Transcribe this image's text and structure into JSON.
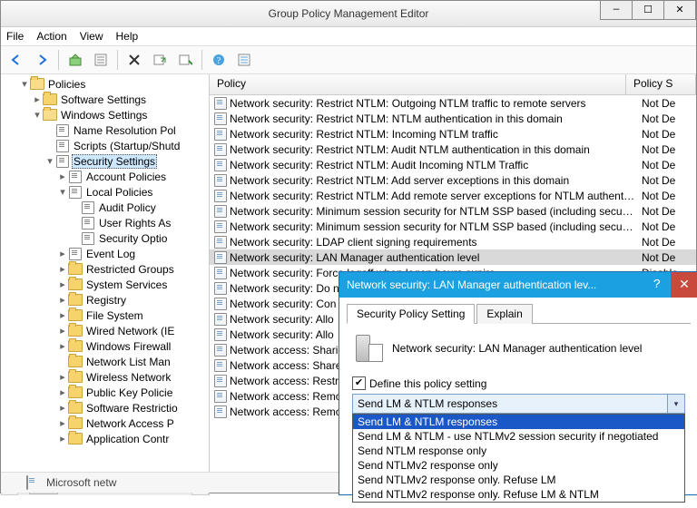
{
  "window": {
    "title": "Group Policy Management Editor",
    "menus": [
      "File",
      "Action",
      "View",
      "Help"
    ]
  },
  "tree": {
    "root": "Policies",
    "items": [
      {
        "depth": 1,
        "twist": "▾",
        "icon": "folder-open",
        "label": "Policies"
      },
      {
        "depth": 2,
        "twist": "▸",
        "icon": "folder",
        "label": "Software Settings"
      },
      {
        "depth": 2,
        "twist": "▾",
        "icon": "folder-open",
        "label": "Windows Settings"
      },
      {
        "depth": 3,
        "twist": "",
        "icon": "leaf",
        "label": "Name Resolution Pol"
      },
      {
        "depth": 3,
        "twist": "",
        "icon": "leaf",
        "label": "Scripts (Startup/Shutd"
      },
      {
        "depth": 3,
        "twist": "▾",
        "icon": "leaf",
        "label": "Security Settings",
        "sel": true
      },
      {
        "depth": 4,
        "twist": "▸",
        "icon": "leaf",
        "label": "Account Policies"
      },
      {
        "depth": 4,
        "twist": "▾",
        "icon": "leaf",
        "label": "Local Policies"
      },
      {
        "depth": 5,
        "twist": "",
        "icon": "leaf",
        "label": "Audit Policy"
      },
      {
        "depth": 5,
        "twist": "",
        "icon": "leaf",
        "label": "User Rights As"
      },
      {
        "depth": 5,
        "twist": "",
        "icon": "leaf",
        "label": "Security Optio"
      },
      {
        "depth": 4,
        "twist": "▸",
        "icon": "leaf",
        "label": "Event Log"
      },
      {
        "depth": 4,
        "twist": "▸",
        "icon": "folder",
        "label": "Restricted Groups"
      },
      {
        "depth": 4,
        "twist": "▸",
        "icon": "folder",
        "label": "System Services"
      },
      {
        "depth": 4,
        "twist": "▸",
        "icon": "folder",
        "label": "Registry"
      },
      {
        "depth": 4,
        "twist": "▸",
        "icon": "folder",
        "label": "File System"
      },
      {
        "depth": 4,
        "twist": "▸",
        "icon": "folder",
        "label": "Wired Network (IE"
      },
      {
        "depth": 4,
        "twist": "▸",
        "icon": "folder",
        "label": "Windows Firewall"
      },
      {
        "depth": 4,
        "twist": "",
        "icon": "folder",
        "label": "Network List Man"
      },
      {
        "depth": 4,
        "twist": "▸",
        "icon": "folder",
        "label": "Wireless Network"
      },
      {
        "depth": 4,
        "twist": "▸",
        "icon": "folder",
        "label": "Public Key Policie"
      },
      {
        "depth": 4,
        "twist": "▸",
        "icon": "folder",
        "label": "Software Restrictio"
      },
      {
        "depth": 4,
        "twist": "▸",
        "icon": "folder",
        "label": "Network Access P"
      },
      {
        "depth": 4,
        "twist": "▸",
        "icon": "folder",
        "label": "Application Contr"
      }
    ]
  },
  "list": {
    "headers": {
      "c1": "Policy",
      "c2": "Policy S"
    },
    "rows": [
      {
        "name": "Network security: Restrict NTLM: Outgoing NTLM traffic to remote servers",
        "val": "Not De"
      },
      {
        "name": "Network security: Restrict NTLM: NTLM authentication in this domain",
        "val": "Not De"
      },
      {
        "name": "Network security: Restrict NTLM: Incoming NTLM traffic",
        "val": "Not De"
      },
      {
        "name": "Network security: Restrict NTLM: Audit NTLM authentication in this domain",
        "val": "Not De"
      },
      {
        "name": "Network security: Restrict NTLM: Audit Incoming NTLM Traffic",
        "val": "Not De"
      },
      {
        "name": "Network security: Restrict NTLM: Add server exceptions in this domain",
        "val": "Not De"
      },
      {
        "name": "Network security: Restrict NTLM: Add remote server exceptions for NTLM authentic...",
        "val": "Not De"
      },
      {
        "name": "Network security: Minimum session security for NTLM SSP based (including secure ...",
        "val": "Not De"
      },
      {
        "name": "Network security: Minimum session security for NTLM SSP based (including secure ...",
        "val": "Not De"
      },
      {
        "name": "Network security: LDAP client signing requirements",
        "val": "Not De"
      },
      {
        "name": "Network security: LAN Manager authentication level",
        "val": "Not De",
        "sel": true
      },
      {
        "name": "Network security: Force logoff when logon hours expire",
        "val": "Disable"
      },
      {
        "name": "Network security: Do n",
        "val": ""
      },
      {
        "name": "Network security: Con",
        "val": ""
      },
      {
        "name": "Network security: Allo",
        "val": ""
      },
      {
        "name": "Network security: Allo",
        "val": ""
      },
      {
        "name": "Network access: Sharin",
        "val": ""
      },
      {
        "name": "Network access: Share",
        "val": ""
      },
      {
        "name": "Network access: Restri",
        "val": ""
      },
      {
        "name": "Network access: Remo",
        "val": ""
      },
      {
        "name": "Network access: Remo",
        "val": ""
      }
    ]
  },
  "dialog": {
    "title": "Network security: LAN Manager authentication lev...",
    "tabs": [
      "Security Policy Setting",
      "Explain"
    ],
    "policy_name": "Network security: LAN Manager authentication level",
    "define_label": "Define this policy setting",
    "define_checked": true,
    "combo_value": "Send LM & NTLM responses",
    "options": [
      "Send LM & NTLM responses",
      "Send LM & NTLM - use NTLMv2 session security if negotiated",
      "Send NTLM response only",
      "Send NTLMv2 response only",
      "Send NTLMv2 response only. Refuse LM",
      "Send NTLMv2 response only. Refuse LM & NTLM"
    ],
    "selected_index": 0
  },
  "statusbar": {
    "text": "Microsoft netw"
  }
}
